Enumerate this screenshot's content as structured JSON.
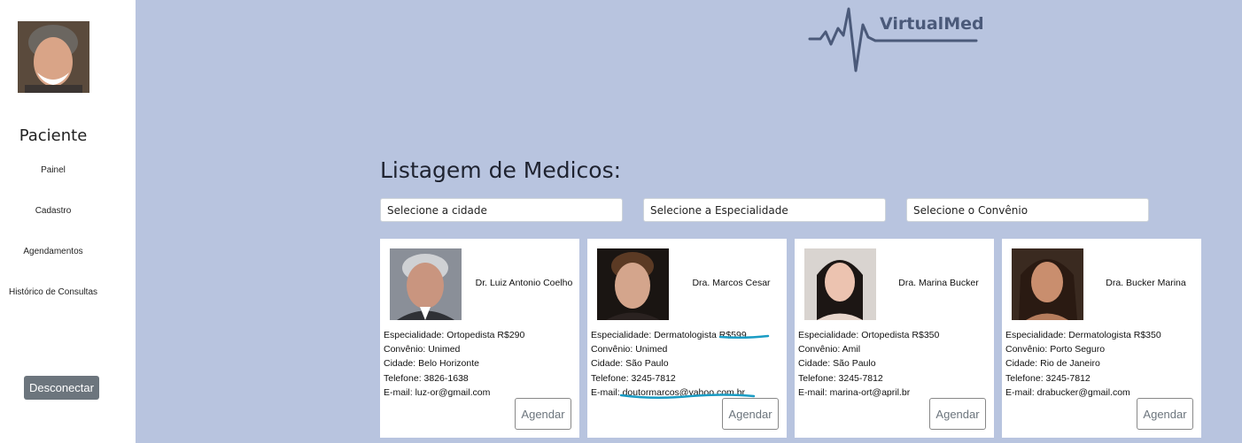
{
  "sidebar": {
    "role": "Paciente",
    "nav": [
      "Painel",
      "Cadastro",
      "Agendamentos",
      "Histórico de Consultas"
    ],
    "disconnect_label": "Desconectar"
  },
  "brand": {
    "name": "VirtualMed"
  },
  "main": {
    "title": "Listagem de Medicos:",
    "filters": [
      "Selecione a cidade",
      "Selecione a Especialidade",
      "Selecione o Convênio"
    ]
  },
  "doctors": [
    {
      "name": "Dr. Luiz Antonio Coelho",
      "specialty": "Especialidade: Ortopedista R$290",
      "insurance": "Convênio: Unimed",
      "city": "Cidade: Belo Horizonte",
      "phone": "Telefone: 3826-1638",
      "email": "E-mail: luz-or@gmail.com",
      "button": "Agendar"
    },
    {
      "name": "Dra. Marcos Cesar",
      "specialty": "Especialidade: Dermatologista  R$599",
      "insurance": "Convênio: Unimed",
      "city": "Cidade: São Paulo",
      "phone": "Telefone: 3245-7812",
      "email": "E-mail: doutormarcos@yahoo.com.br",
      "button": "Agendar"
    },
    {
      "name": "Dra. Marina Bucker",
      "specialty": "Especialidade: Ortopedista R$350",
      "insurance": "Convênio: Amil",
      "city": "Cidade: São Paulo",
      "phone": "Telefone: 3245-7812",
      "email": "E-mail: marina-ort@april.br",
      "button": "Agendar"
    },
    {
      "name": "Dra. Bucker Marina",
      "specialty": "Especialidade: Dermatologista R$350",
      "insurance": "Convênio: Porto Seguro",
      "city": "Cidade: Rio de Janeiro",
      "phone": "Telefone: 3245-7812",
      "email": "E-mail: drabucker@gmail.com",
      "button": "Agendar"
    }
  ],
  "colors": {
    "page_bg": "#b8c4df",
    "sidebar_bg": "#ffffff",
    "disconnect_bg": "#6c757d",
    "logo_color": "#4b5a7a",
    "annotation": "#1a9cc4"
  }
}
